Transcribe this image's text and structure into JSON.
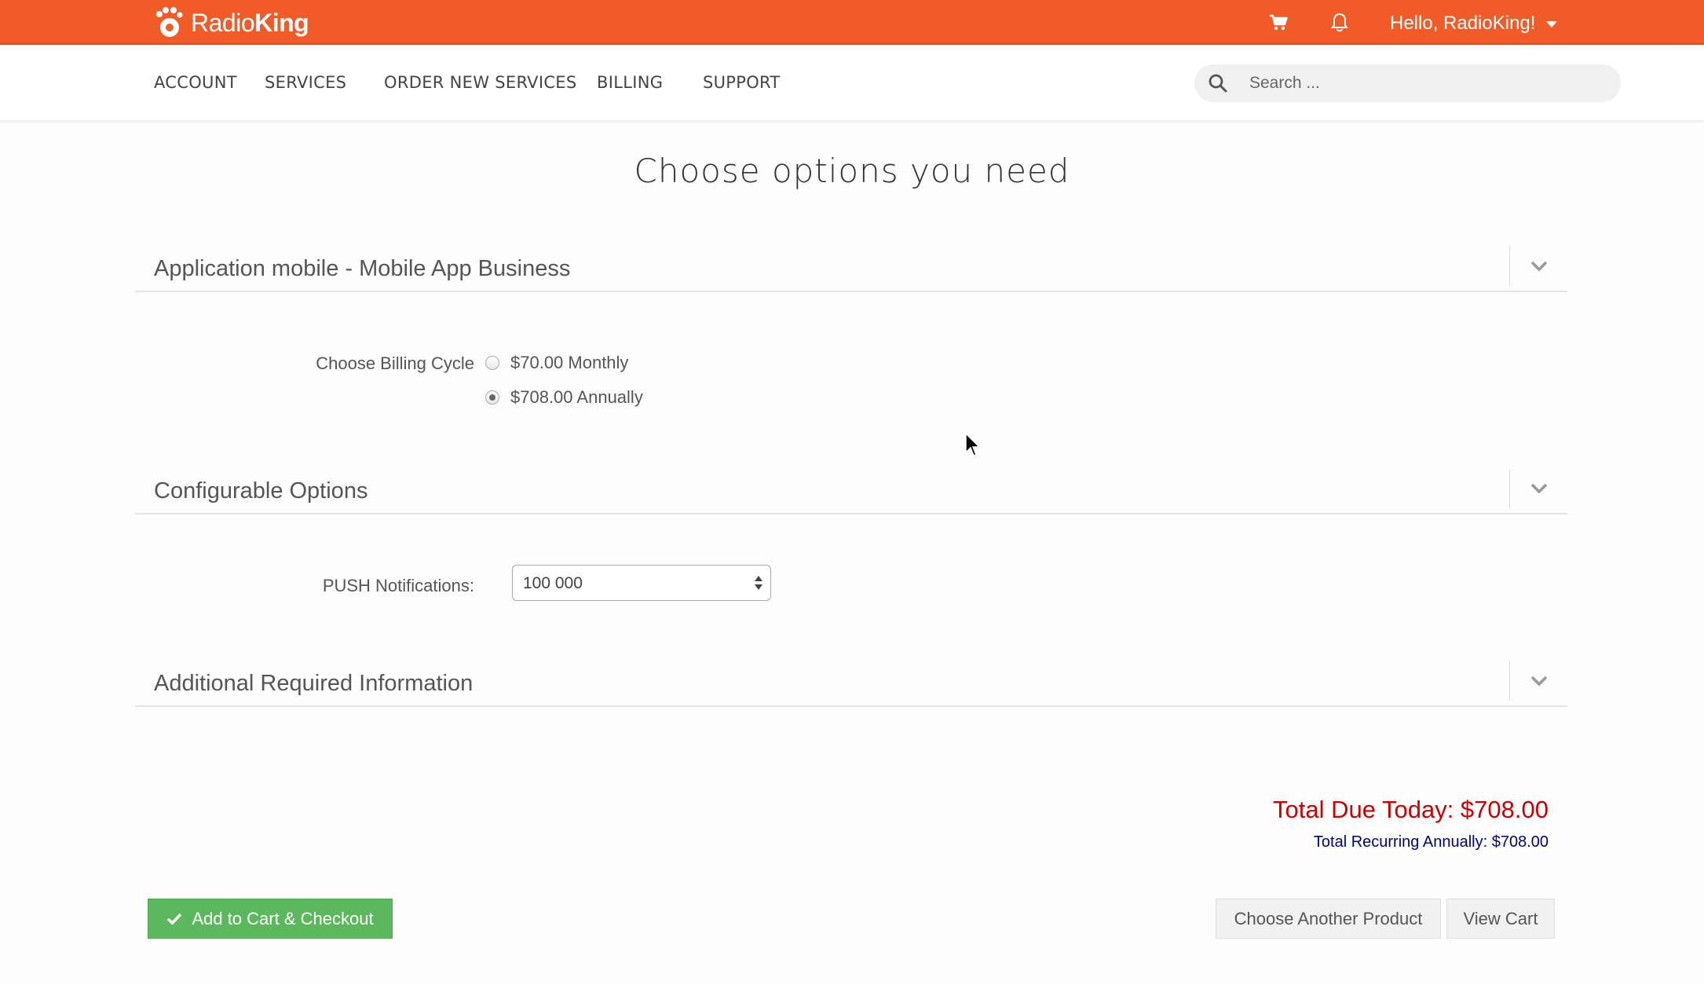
{
  "brand": {
    "name_light": "Radio",
    "name_bold": "King",
    "color": "#f15b28"
  },
  "topbar": {
    "cart_icon": "cart-icon",
    "notification_icon": "bell-icon",
    "greeting": "Hello, RadioKing!"
  },
  "nav": {
    "items": [
      {
        "label": "ACCOUNT"
      },
      {
        "label": "SERVICES"
      },
      {
        "label": "ORDER NEW SERVICES"
      },
      {
        "label": "BILLING"
      },
      {
        "label": "SUPPORT"
      }
    ],
    "search_placeholder": "Search ..."
  },
  "page": {
    "title": "Choose options you need"
  },
  "product_panel": {
    "title": "Application mobile - Mobile App Business",
    "billing_label": "Choose Billing Cycle",
    "options": [
      {
        "label": "$70.00 Monthly",
        "checked": false
      },
      {
        "label": "$708.00 Annually",
        "checked": true
      }
    ]
  },
  "config_panel": {
    "title": "Configurable Options",
    "push_label": "PUSH Notifications:",
    "push_value": "100 000"
  },
  "additional_panel": {
    "title": "Additional Required Information"
  },
  "totals": {
    "due_today": "Total Due Today: $708.00",
    "recurring": "Total Recurring Annually: $708.00",
    "due_color": "#cc0000",
    "recurring_color": "#000080"
  },
  "actions": {
    "checkout": "Add to Cart & Checkout",
    "choose_another": "Choose Another Product",
    "view_cart": "View Cart"
  }
}
